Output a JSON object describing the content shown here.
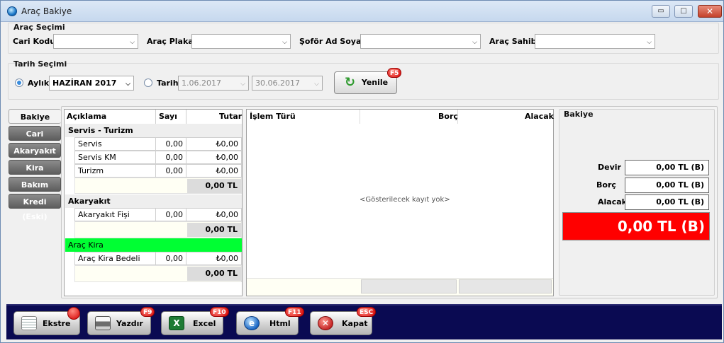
{
  "window": {
    "title": "Araç Bakiye",
    "minimize": "▭",
    "maximize": "□",
    "close": "✕"
  },
  "vehicle_selection": {
    "group_label": "Araç Seçimi",
    "cari_kodu_label": "Cari Kodu",
    "cari_kodu_value": "",
    "arac_plaka_label": "Araç Plaka",
    "arac_plaka_value": "",
    "sofor_label": "Şoför Ad Soyad",
    "sofor_value": "",
    "arac_sahibi_label": "Araç Sahibi",
    "arac_sahibi_value": ""
  },
  "date_selection": {
    "group_label": "Tarih Seçimi",
    "monthly_label": "Aylık",
    "monthly_value": "HAZİRAN 2017",
    "date_label": "Tarih",
    "date_from": "1.06.2017",
    "date_to": "30.06.2017",
    "refresh_label": "Yenile",
    "refresh_key": "F5"
  },
  "side_tabs": [
    "Bakiye",
    "Cari",
    "Akaryakıt",
    "Kira",
    "Bakım",
    "Kredi (Eski)"
  ],
  "summary_table": {
    "headers": {
      "desc": "Açıklama",
      "count": "Sayı",
      "amount": "Tutar"
    },
    "sections": [
      {
        "title": "Servis - Turizm",
        "rows": [
          {
            "desc": "Servis",
            "count": "0,00",
            "amount": "₺0,00"
          },
          {
            "desc": "Servis KM",
            "count": "0,00",
            "amount": "₺0,00"
          },
          {
            "desc": "Turizm",
            "count": "0,00",
            "amount": "₺0,00"
          }
        ],
        "total": "0,00 TL"
      },
      {
        "title": "Akaryakıt",
        "rows": [
          {
            "desc": "Akaryakıt Fişi",
            "count": "0,00",
            "amount": "₺0,00"
          }
        ],
        "total": "0,00 TL"
      },
      {
        "title": "Araç Kira",
        "rows": [
          {
            "desc": "Araç Kira Bedeli",
            "count": "0,00",
            "amount": "₺0,00"
          }
        ],
        "total": "0,00 TL"
      }
    ]
  },
  "transactions": {
    "headers": {
      "type": "İşlem Türü",
      "debit": "Borç",
      "credit": "Alacak"
    },
    "empty_text": "<Gösterilecek kayıt yok>"
  },
  "balance": {
    "group_label": "Bakiye",
    "devir_label": "Devir",
    "devir_value": "0,00 TL (B)",
    "borc_label": "Borç",
    "borc_value": "0,00 TL (B)",
    "alacak_label": "Alacak",
    "alacak_value": "0,00 TL (B)",
    "total": "0,00 TL (B)"
  },
  "bottom_buttons": [
    {
      "label": "Ekstre",
      "key": ""
    },
    {
      "label": "Yazdır",
      "key": "F9"
    },
    {
      "label": "Excel",
      "key": "F10"
    },
    {
      "label": "Html",
      "key": "F11"
    },
    {
      "label": "Kapat",
      "key": "ESC"
    }
  ],
  "colors": {
    "green_section": "#00ff33",
    "balance_red": "#ff0000",
    "bottom_bar": "#0a0a52"
  }
}
